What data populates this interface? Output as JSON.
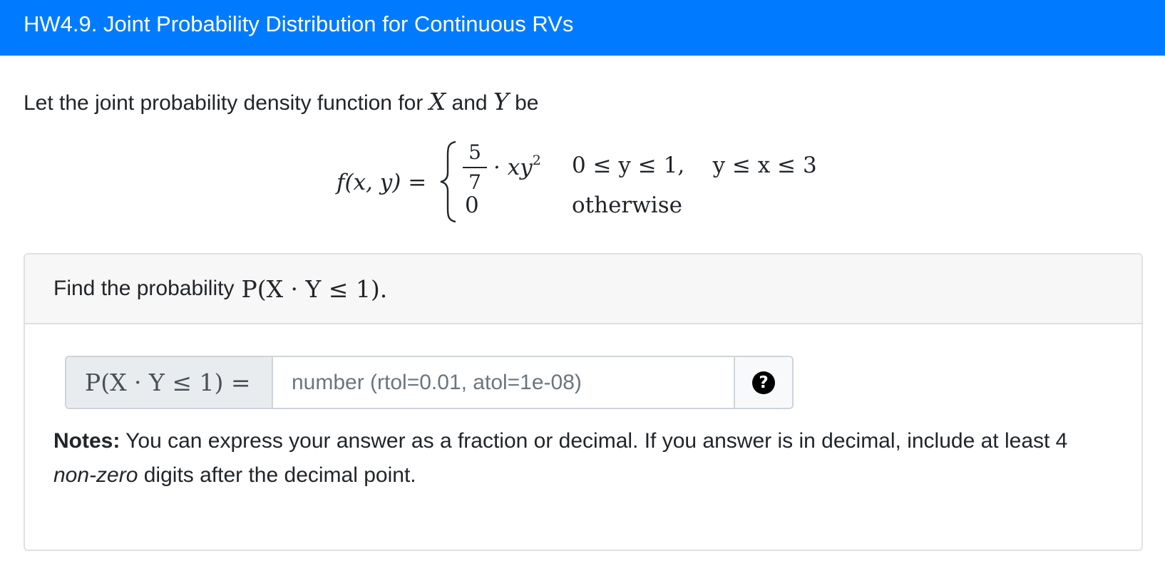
{
  "header": {
    "title": "HW4.9. Joint Probability Distribution for Continuous RVs"
  },
  "intro": {
    "prefix": "Let the joint probability density function for",
    "var_x": "X",
    "conj": "and",
    "var_y": "Y",
    "suffix": "be"
  },
  "equation": {
    "lhs_func": "f",
    "lhs_args": "(x, y) =",
    "frac_num": "5",
    "frac_den": "7",
    "case1_expr": "· xy",
    "case1_exp": "2",
    "case1_cond": "0 ≤ y ≤ 1,    y ≤ x ≤ 3",
    "case2_val": "0",
    "case2_cond": "otherwise"
  },
  "question": {
    "prompt": "Find the probability",
    "expr": "P(X · Y ≤ 1)."
  },
  "answer": {
    "label": "P(X · Y ≤ 1) =",
    "placeholder": "number (rtol=0.01, atol=1e-08)",
    "value": "",
    "help_glyph": "?"
  },
  "notes": {
    "bold": "Notes:",
    "text1": " You can express your answer as a fraction or decimal. If you answer is in decimal, include at least 4 ",
    "italic": "non-zero",
    "text2": " digits after the decimal point."
  },
  "colors": {
    "header_bg": "#007bff",
    "card_header_bg": "#f7f7f7",
    "input_label_bg": "#e9ecef"
  }
}
